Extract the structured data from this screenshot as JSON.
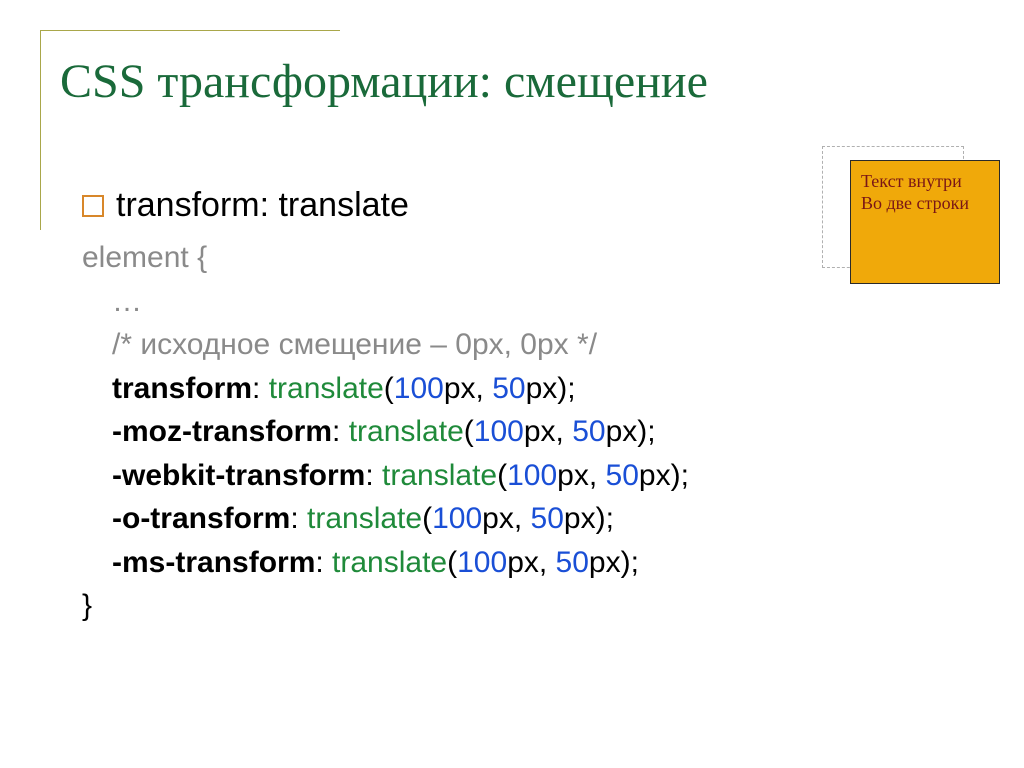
{
  "slide": {
    "title": "CSS трансформации: смещение",
    "bullet": "transform: translate",
    "demo": {
      "line1": "Текст внутри",
      "line2": "Во две строки"
    },
    "code": {
      "selector": "element {",
      "ellipsis": "…",
      "comment": "/* исходное смещение – 0px, 0px */",
      "props": [
        {
          "name": "transform",
          "fn": "translate",
          "a": "100",
          "a_unit": "px, ",
          "b": "50",
          "b_unit": "px);"
        },
        {
          "name": "-moz-transform",
          "fn": "translate",
          "a": "100",
          "a_unit": "px, ",
          "b": "50",
          "b_unit": "px);"
        },
        {
          "name": "-webkit-transform",
          "fn": "translate",
          "a": "100",
          "a_unit": "px, ",
          "b": "50",
          "b_unit": "px);"
        },
        {
          "name": "-o-transform",
          "fn": "translate",
          "a": "100",
          "a_unit": "px, ",
          "b": "50",
          "b_unit": "px);"
        },
        {
          "name": "-ms-transform",
          "fn": "translate",
          "a": "100",
          "a_unit": "px, ",
          "b": "50",
          "b_unit": "px);"
        }
      ],
      "close": "}"
    }
  }
}
